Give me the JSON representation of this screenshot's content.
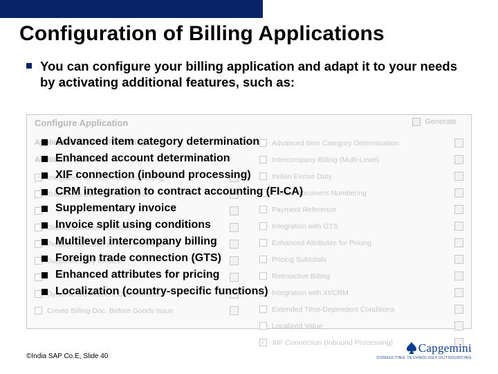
{
  "title": "Configuration of Billing Applications",
  "lead": "You can configure your billing application and adapt it to your needs by activating additional features, such as:",
  "bg": {
    "caption": "Configure Application",
    "generate": "Generate",
    "col1_head": "Application   CRMB   CRM Billing",
    "col1_sub": "Additional Features",
    "col1": [
      "Integration with Contract Accounting",
      "Transfer to BW with INCL Data",
      "",
      "Distribution and Allocation",
      "Product Tax Code in Third-Party Order",
      "Supplementary Invoice",
      "",
      "Dynamic CC Account Determination",
      "Create Billing Doc. Before Goods Issue"
    ],
    "col2": [
      "Advanced Item Category Determination",
      "Intercompany Billing (Multi-Level)",
      "Indian Excise Duty",
      "Official Document Numbering",
      "Payment Reference",
      "Integration with GTS",
      "Enhanced Attributes for Pricing",
      "Pricing Subtotals",
      "Retroactive Billing",
      "Integration with XI/CRM",
      "Extended Time-Dependent Conditions",
      "Localized Value",
      "XIF Connection (Inbound Processing)"
    ]
  },
  "items": [
    "Advanced item category determination",
    "Enhanced account determination",
    "XIF connection (inbound processing)",
    "CRM integration to contract accounting (FI-CA)",
    "Supplementary invoice",
    "Invoice split using conditions",
    "Multilevel intercompany billing",
    "Foreign trade connection (GTS)",
    "Enhanced attributes for pricing",
    "Localization (country-specific functions)"
  ],
  "footer": "©India SAP Co.E, Slide 40",
  "logo": {
    "word": "Capgemini",
    "tag": "CONSULTING.TECHNOLOGY.OUTSOURCING"
  }
}
